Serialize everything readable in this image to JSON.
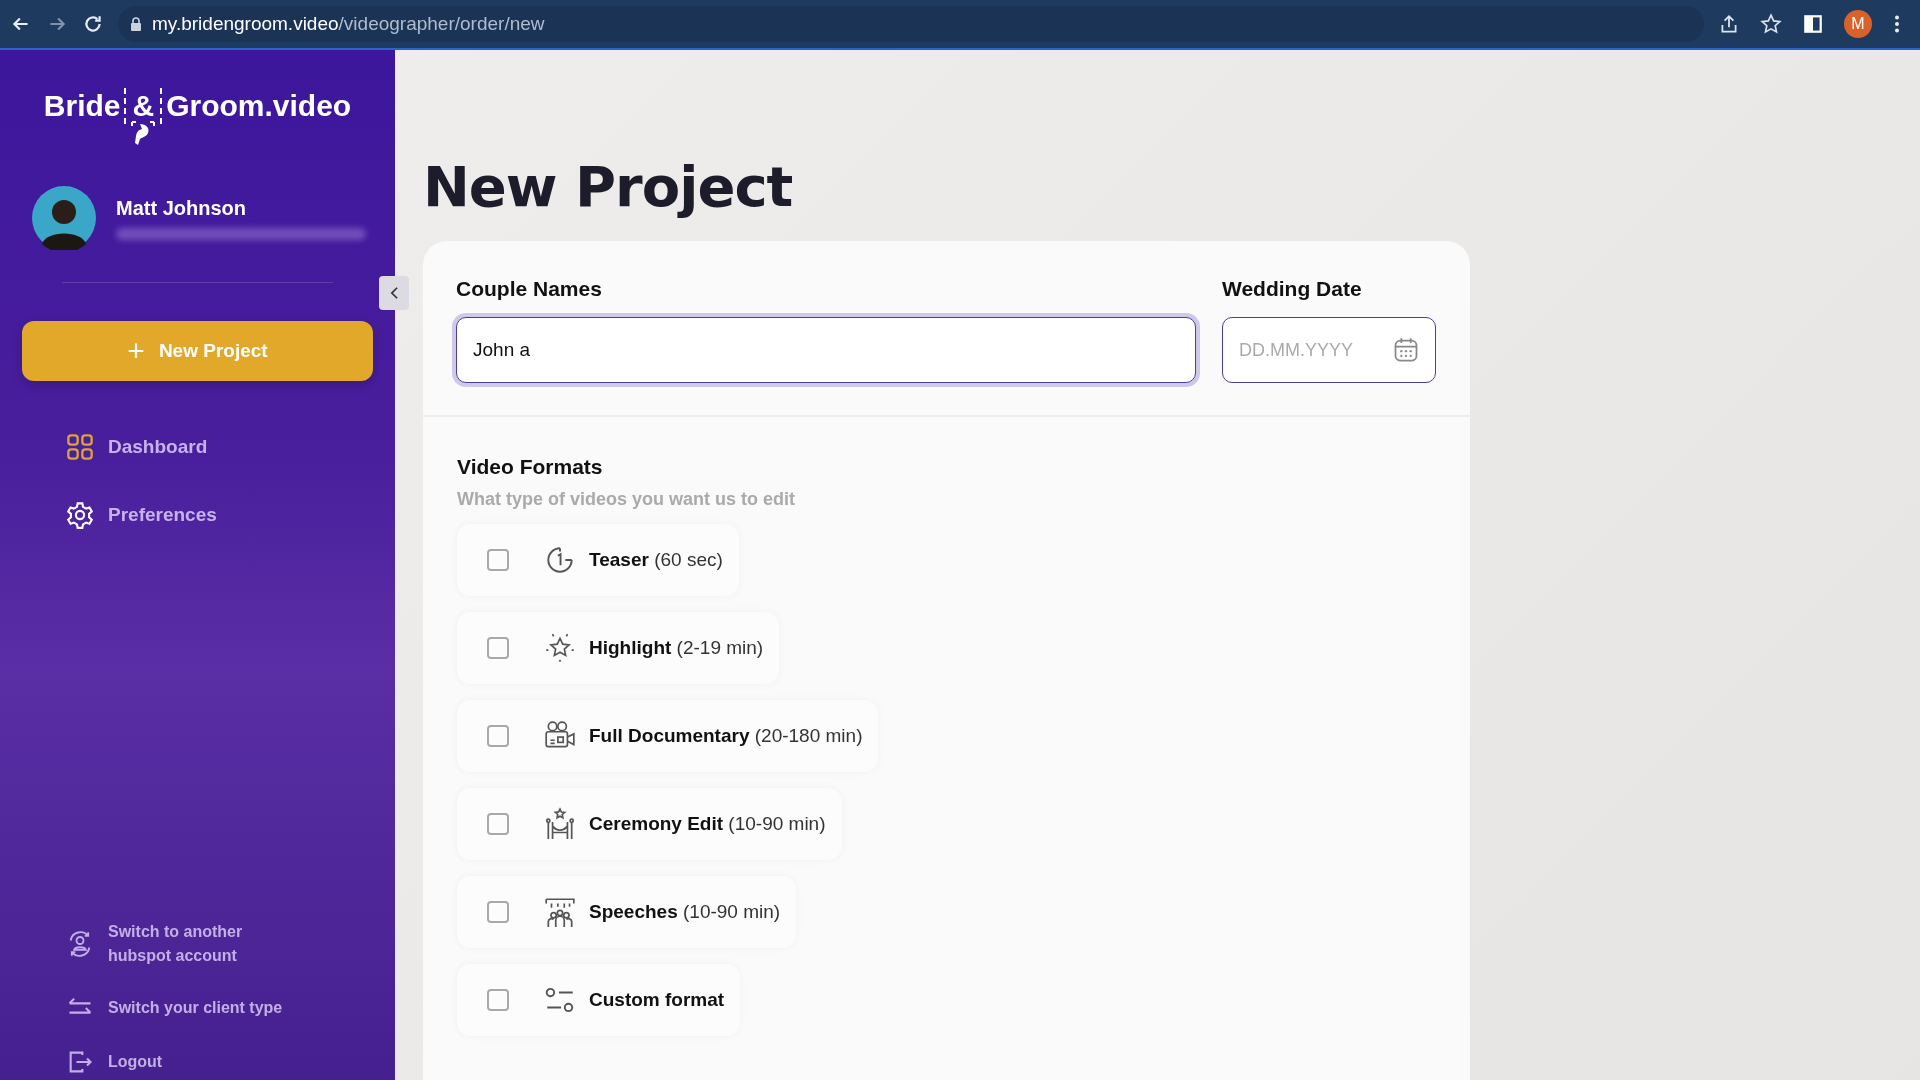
{
  "browser": {
    "url_host": "my.bridengroom.video",
    "url_path": "/videographer/order/new",
    "profile_initial": "M"
  },
  "sidebar": {
    "logo": {
      "left": "Bride",
      "mark": "&",
      "right": "Groom.video"
    },
    "user": {
      "name": "Matt Johnson"
    },
    "new_project_button": {
      "icon": "+",
      "label": "New Project"
    },
    "nav": [
      {
        "kind": "dashboard",
        "label": "Dashboard"
      },
      {
        "kind": "preferences",
        "label": "Preferences"
      }
    ],
    "footer": [
      {
        "kind": "switch-account",
        "label": "Switch to another hubspot account"
      },
      {
        "kind": "client-type",
        "label": "Switch your client type"
      },
      {
        "kind": "logout",
        "label": "Logout"
      }
    ]
  },
  "page": {
    "title": "New Project",
    "couple_names": {
      "label": "Couple Names",
      "value": "John a"
    },
    "wedding_date": {
      "label": "Wedding Date",
      "placeholder": "DD.MM.YYYY"
    },
    "video_formats": {
      "title": "Video Formats",
      "subtitle": "What type of videos you want us to edit",
      "options": [
        {
          "kind": "teaser",
          "label": "**Teaser** (60 sec)",
          "checked": false
        },
        {
          "kind": "highlight",
          "label": "**Highlight** (2-19 min)",
          "checked": false
        },
        {
          "kind": "documentary",
          "label": "**Full Documentary** (20-180 min)",
          "checked": false
        },
        {
          "kind": "ceremony",
          "label": "**Ceremony Edit** (10-90 min)",
          "checked": false
        },
        {
          "kind": "speeches",
          "label": "**Speeches** (10-90 min)",
          "checked": false
        },
        {
          "kind": "custom",
          "label": "**Custom format**",
          "checked": false
        }
      ]
    }
  }
}
